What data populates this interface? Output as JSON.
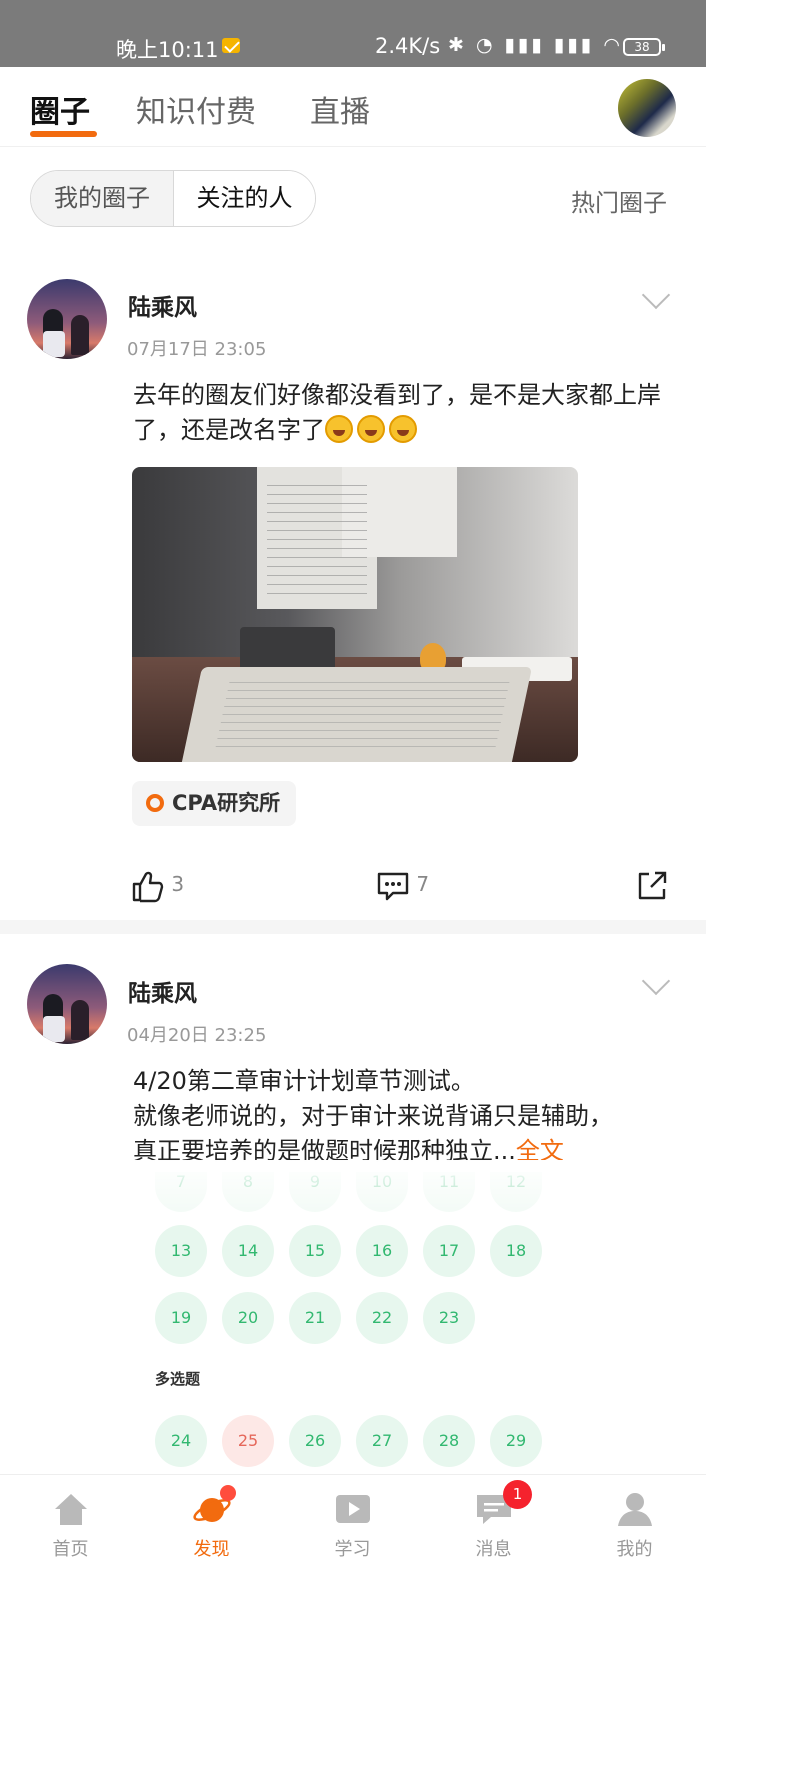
{
  "status_bar": {
    "time": "晚上10:11",
    "network_speed": "2.4K/s",
    "icons": "✱ ◔ ▮▮▮ ▮▮▮ ◠",
    "battery": "38"
  },
  "header": {
    "tabs": [
      {
        "label": "圈子",
        "active": true
      },
      {
        "label": "知识付费",
        "active": false
      },
      {
        "label": "直播",
        "active": false
      }
    ]
  },
  "filter": {
    "segments": [
      {
        "label": "我的圈子",
        "active": false
      },
      {
        "label": "关注的人",
        "active": true
      }
    ],
    "hot_label": "热门圈子"
  },
  "posts": [
    {
      "author": "陆乘风",
      "time": "07月17日 23:05",
      "text": "去年的圈友们好像都没看到了，是不是大家都上岸了，还是改名字了",
      "emoji_count": 3,
      "tag": "CPA研究所",
      "likes": "3",
      "comments": "7"
    },
    {
      "author": "陆乘风",
      "time": "04月20日 23:25",
      "text_line1": "4/20第二章审计计划章节测试。",
      "text_line2": "就像老师说的，对于审计来说背诵只是辅助，",
      "text_line3": "真正要培养的是做题时候那种独立...",
      "more": "全文",
      "grid": {
        "row0_partial": [
          "7",
          "8",
          "9",
          "10",
          "11",
          "12"
        ],
        "row1": [
          "13",
          "14",
          "15",
          "16",
          "17",
          "18"
        ],
        "row2": [
          "19",
          "20",
          "21",
          "22",
          "23"
        ],
        "section": "多选题",
        "row3": [
          "24",
          "25",
          "26",
          "27",
          "28",
          "29"
        ],
        "wrong": [
          "25"
        ]
      }
    }
  ],
  "bottom_nav": [
    {
      "label": "首页",
      "icon": "home-icon"
    },
    {
      "label": "发现",
      "icon": "planet-icon",
      "active": true
    },
    {
      "label": "学习",
      "icon": "play-icon"
    },
    {
      "label": "消息",
      "icon": "message-icon",
      "badge": "1"
    },
    {
      "label": "我的",
      "icon": "profile-icon"
    }
  ],
  "colors": {
    "accent": "#f26b0f",
    "badge": "#f5222d",
    "grid_ok": "#32b870",
    "grid_wrong": "#e5675a"
  }
}
